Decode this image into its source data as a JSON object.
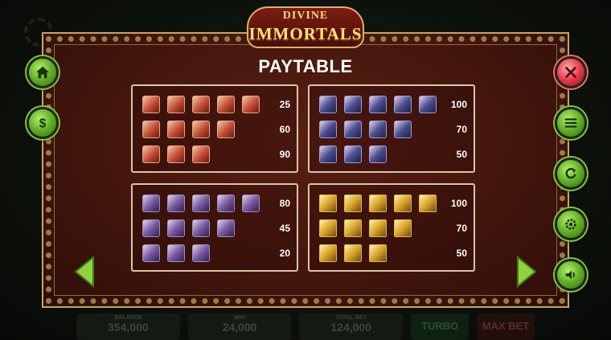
{
  "logo": {
    "line1": "DIVINE",
    "line2": "IMMORTALS"
  },
  "title": "PAYTABLE",
  "panels": [
    {
      "symbol": "red-immortal-symbol",
      "payouts": [
        {
          "count": 5,
          "value": "25"
        },
        {
          "count": 4,
          "value": "60"
        },
        {
          "count": 3,
          "value": "90"
        }
      ]
    },
    {
      "symbol": "blue-immortal-symbol",
      "payouts": [
        {
          "count": 5,
          "value": "100"
        },
        {
          "count": 4,
          "value": "70"
        },
        {
          "count": 3,
          "value": "50"
        }
      ]
    },
    {
      "symbol": "purple-immortal-symbol",
      "payouts": [
        {
          "count": 5,
          "value": "80"
        },
        {
          "count": 4,
          "value": "45"
        },
        {
          "count": 3,
          "value": "20"
        }
      ]
    },
    {
      "symbol": "gold-scroll-symbol",
      "payouts": [
        {
          "count": 5,
          "value": "100"
        },
        {
          "count": 4,
          "value": "70"
        },
        {
          "count": 3,
          "value": "50"
        }
      ]
    }
  ],
  "left_buttons": [
    {
      "icon": "home-icon"
    },
    {
      "icon": "dollar-icon"
    }
  ],
  "right_buttons": [
    {
      "icon": "close-icon"
    },
    {
      "icon": "menu-icon"
    },
    {
      "icon": "refresh-icon"
    },
    {
      "icon": "settings-icon"
    },
    {
      "icon": "sound-icon"
    }
  ],
  "nav": {
    "prev": "arrow-left-icon",
    "next": "arrow-right-icon"
  },
  "bottom_bar": {
    "balance_label": "BALANCE",
    "balance_value": "354,000",
    "win_label": "WIN",
    "win_value": "24,000",
    "total_bet_label": "TOTAL BET",
    "total_bet_value": "124,000",
    "turbo_label": "TURBO",
    "max_bet_label": "MAX BET"
  },
  "colors": {
    "frame_gold": "#c6a565",
    "panel_bg": "#43160d",
    "button_green": "#5fae26",
    "button_red": "#e8394b"
  }
}
